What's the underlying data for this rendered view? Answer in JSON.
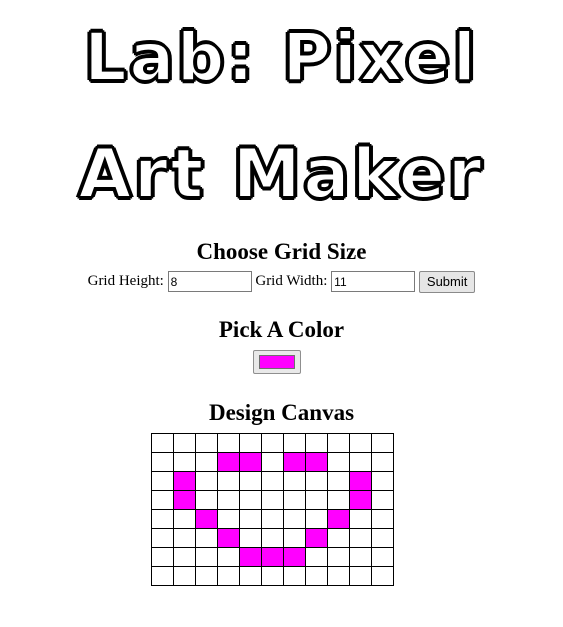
{
  "title": {
    "line1": "Lab: Pixel",
    "line2": "Art Maker"
  },
  "grid_size": {
    "heading": "Choose Grid Size",
    "height_label": "Grid Height:",
    "height_value": "8",
    "width_label": "Grid Width:",
    "width_value": "11",
    "submit_label": "Submit"
  },
  "color": {
    "heading": "Pick A Color",
    "value": "#ff00ff"
  },
  "canvas": {
    "heading": "Design Canvas",
    "rows": 8,
    "cols": 11,
    "fill_color": "#ff00ff",
    "filled_cells": [
      [
        1,
        3
      ],
      [
        1,
        4
      ],
      [
        1,
        6
      ],
      [
        1,
        7
      ],
      [
        2,
        1
      ],
      [
        2,
        9
      ],
      [
        3,
        1
      ],
      [
        3,
        9
      ],
      [
        4,
        2
      ],
      [
        4,
        8
      ],
      [
        5,
        3
      ],
      [
        5,
        7
      ],
      [
        6,
        4
      ],
      [
        6,
        5
      ],
      [
        6,
        6
      ]
    ]
  }
}
